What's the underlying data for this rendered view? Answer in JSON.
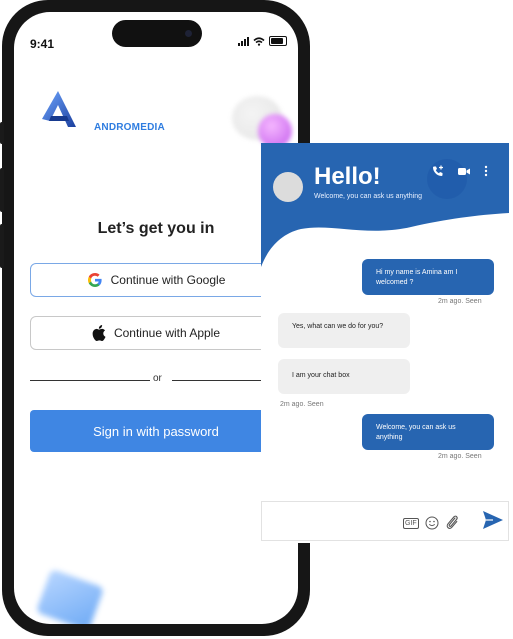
{
  "status_bar": {
    "time": "9:41"
  },
  "brand": {
    "name": "ANDROMEDIA"
  },
  "login": {
    "heading": "Let’s get you in",
    "google_label": "Continue with Google",
    "apple_label": "Continue with Apple",
    "divider_text": "or",
    "primary_label": "Sign in with password"
  },
  "chat": {
    "title": "Hello!",
    "subtitle": "Welcome, you can ask us anything",
    "messages": [
      {
        "from": "user",
        "text": "Hi my name is Amina am I welcomed ?",
        "meta": "2m ago. Seen"
      },
      {
        "from": "agent",
        "text": "Yes, what can we do for you?"
      },
      {
        "from": "agent",
        "text": "I am your chat box",
        "meta": "2m ago. Seen"
      },
      {
        "from": "user",
        "text": "Welcome, you can ask us anything",
        "meta": "2m ago. Seen"
      }
    ],
    "composer": {
      "placeholder": "",
      "gif_label": "GIF"
    }
  },
  "colors": {
    "accent": "#3f86e3",
    "chat_header": "#2765b1",
    "brand_text": "#2f7de0"
  },
  "icons": [
    "android-a-logo",
    "google-icon",
    "apple-icon",
    "phone-add-icon",
    "video-icon",
    "more-vertical-icon",
    "emoji-icon",
    "attachment-icon",
    "send-icon"
  ]
}
